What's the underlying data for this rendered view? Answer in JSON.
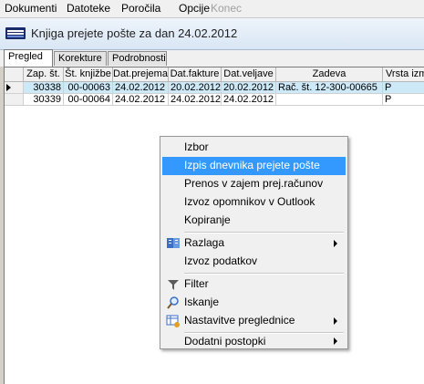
{
  "menubar": {
    "items": [
      {
        "label": "Dokumenti",
        "enabled": true
      },
      {
        "label": "Datoteke",
        "enabled": true
      },
      {
        "label": "Poročila",
        "enabled": true
      },
      {
        "label": "Opcije",
        "enabled": true
      },
      {
        "label": "Konec",
        "enabled": false
      }
    ]
  },
  "window": {
    "title": "Knjiga prejete pošte za dan 24.02.2012"
  },
  "tabs": [
    {
      "label": "Pregled",
      "active": true
    },
    {
      "label": "Korekture",
      "active": false
    },
    {
      "label": "Podrobnosti",
      "active": false
    }
  ],
  "grid": {
    "columns": [
      "Zap. št.",
      "Št. knjižbe",
      "Dat.prejema",
      "Dat.fakture",
      "Dat.veljave",
      "Zadeva",
      "Vrsta izmen"
    ],
    "rows": [
      {
        "cells": [
          "30338",
          "00-00063",
          "24.02.2012",
          "20.02.2012",
          "20.02.2012",
          "Rač. št. 12-300-00665",
          "P"
        ],
        "selected": true
      },
      {
        "cells": [
          "30339",
          "00-00064",
          "24.02.2012",
          "24.02.2012",
          "24.02.2012",
          "",
          "P"
        ],
        "selected": false
      }
    ]
  },
  "context_menu": {
    "items": [
      {
        "label": "Izbor"
      },
      {
        "label": "Izpis dnevnika prejete pošte",
        "highlighted": true
      },
      {
        "label": "Prenos v zajem prej.računov"
      },
      {
        "label": "Izvoz opomnikov v Outlook"
      },
      {
        "label": "Kopiranje"
      },
      {
        "label": "Razlaga",
        "submenu": true,
        "icon": "help-book-icon"
      },
      {
        "label": "Izvoz podatkov"
      },
      {
        "label": "Filter",
        "icon": "funnel-icon"
      },
      {
        "label": "Iskanje",
        "icon": "magnifier-icon"
      },
      {
        "label": "Nastavitve preglednice",
        "submenu": true,
        "icon": "grid-settings-icon"
      },
      {
        "label": "Dodatni postopki",
        "submenu": true
      }
    ]
  },
  "colors": {
    "selection": "#cde8f7",
    "highlight": "#3399ff",
    "title_gradient_top": "#eef4fb"
  }
}
